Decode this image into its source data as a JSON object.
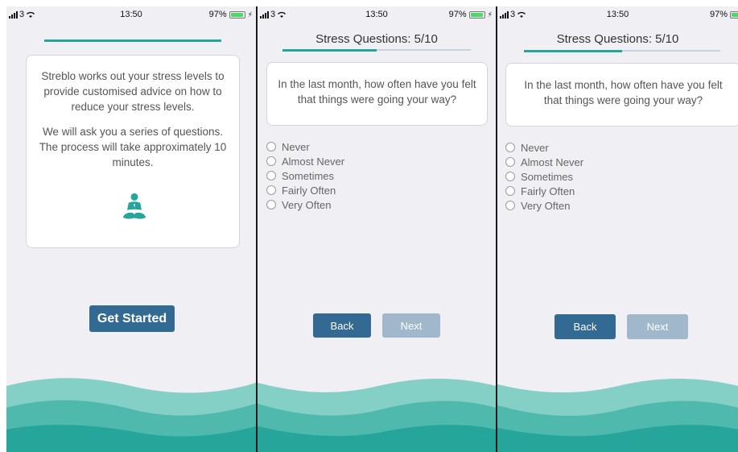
{
  "status_bar": {
    "signal": "3",
    "time": "13:50",
    "battery": "97%"
  },
  "colors": {
    "teal": "#26a69a",
    "primary_button": "#336a94",
    "disabled_button": "#a1b8cc",
    "background": "#f0eff4"
  },
  "screens": [
    {
      "progress_fraction": 1.0,
      "intro_text": "Streblo works out your stress levels to provide customised advice on how to reduce your stress levels.",
      "detail_text": "We will ask you a series of questions. The process will take approximately 10 minutes.",
      "icon": "meditation-icon",
      "start_button": "Get Started"
    },
    {
      "title": "Stress Questions: 5/10",
      "progress_fraction": 0.5,
      "question": "In the last month, how often have you felt that things were going your way?",
      "options": [
        "Never",
        "Almost Never",
        "Sometimes",
        "Fairly Often",
        "Very Often"
      ],
      "back_button": "Back",
      "next_button": "Next"
    },
    {
      "title": "Stress Questions: 5/10",
      "progress_fraction": 0.5,
      "question": "In the last month, how often have you felt that things were going your way?",
      "options": [
        "Never",
        "Almost Never",
        "Sometimes",
        "Fairly Often",
        "Very Often"
      ],
      "back_button": "Back",
      "next_button": "Next"
    }
  ]
}
